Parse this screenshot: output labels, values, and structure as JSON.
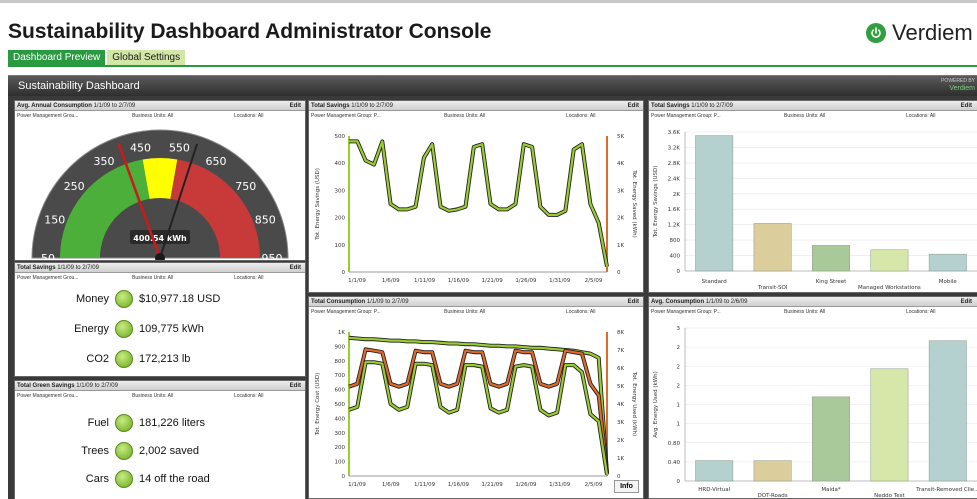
{
  "header": {
    "title": "Sustainability Dashboard Administrator Console",
    "logo_text": "Verdiem",
    "logo_suffix": "®"
  },
  "tabs": [
    {
      "label": "Dashboard Preview",
      "active": true
    },
    {
      "label": "Global Settings",
      "active": false
    }
  ],
  "dashboard": {
    "title": "Sustainability Dashboard",
    "powered_line1": "POWERED BY",
    "powered_line2": "Verdiem"
  },
  "filters": {
    "pmg": "Power Management Grou...",
    "pmg_short": "Power Management Group: P...",
    "bu": "Business Units: All",
    "loc": "Locations: All"
  },
  "panels": {
    "avg_annual": {
      "title": "Avg. Annual Consumption",
      "range": "1/1/09 to 2/7/09",
      "edit": "Edit"
    },
    "total_savings_1": {
      "title": "Total Savings",
      "range": "1/1/09 to 2/7/09",
      "edit": "Edit"
    },
    "green_savings": {
      "title": "Total Green Savings",
      "range": "1/1/09 to 2/7/09",
      "edit": "Edit"
    },
    "total_savings_line": {
      "title": "Total Savings",
      "range": "1/1/09 to 2/7/09",
      "edit": "Edit"
    },
    "total_consumption": {
      "title": "Total Consumption",
      "range": "1/1/09 to 2/7/09",
      "edit": "Edit"
    },
    "total_savings_bar": {
      "title": "Total Savings",
      "range": "1/1/09 to 2/7/09",
      "edit": "Edit"
    },
    "avg_consumption_bar": {
      "title": "Avg. Consumption",
      "range": "1/1/09 to 2/6/09",
      "edit": "Edit"
    }
  },
  "savings_metrics": [
    {
      "label": "Money",
      "value": "$10,977.18  USD",
      "icon": "money-icon"
    },
    {
      "label": "Energy",
      "value": "109,775  kWh",
      "icon": "bulb-icon"
    },
    {
      "label": "CO2",
      "value": "172,213  lb",
      "icon": "co2-icon"
    }
  ],
  "green_metrics": [
    {
      "label": "Fuel",
      "value": "181,226  liters",
      "icon": "fuel-icon"
    },
    {
      "label": "Trees",
      "value": "2,002  saved",
      "icon": "tree-icon"
    },
    {
      "label": "Cars",
      "value": "14  off the road",
      "icon": "car-icon"
    }
  ],
  "info_button": "Info",
  "chart_data": [
    {
      "type": "gauge",
      "tick_labels": [
        "50",
        "150",
        "250",
        "350",
        "450",
        "550",
        "650",
        "750",
        "850",
        "950"
      ],
      "value": 400.54,
      "value_label": "400.54 kWh",
      "zones": [
        {
          "from": 50,
          "to": 450,
          "color": "#4caf3a"
        },
        {
          "from": 450,
          "to": 550,
          "color": "#ffff00"
        },
        {
          "from": 550,
          "to": 950,
          "color": "#c83a3a"
        }
      ],
      "target": 590
    },
    {
      "type": "line",
      "x_ticks": [
        "1/1/09",
        "1/6/09",
        "1/11/09",
        "1/16/09",
        "1/21/09",
        "1/26/09",
        "1/31/09",
        "2/5/09"
      ],
      "ylabel": "Tot. Energy Savings (USD)",
      "y2label": "Tot. Energy Saved (kWh)",
      "ylim": [
        0,
        500
      ],
      "y_ticks": [
        "0",
        "100",
        "200",
        "300",
        "400",
        "500"
      ],
      "y2_ticks": [
        "0",
        "1K",
        "2K",
        "3K",
        "4K",
        "5K"
      ],
      "series": [
        {
          "color": "#9acd32",
          "values": [
            480,
            480,
            410,
            395,
            480,
            250,
            230,
            230,
            240,
            420,
            470,
            240,
            225,
            230,
            240,
            460,
            470,
            250,
            230,
            230,
            250,
            470,
            460,
            240,
            210,
            210,
            225,
            450,
            470,
            250,
            180,
            20
          ]
        }
      ]
    },
    {
      "type": "line",
      "x_ticks": [
        "1/1/09",
        "1/6/09",
        "1/11/09",
        "1/16/09",
        "1/21/09",
        "1/26/09",
        "1/31/09",
        "2/5/09"
      ],
      "ylabel": "Tot. Energy Cost (USD)",
      "y2label": "Tot. Energy Used (kWh)",
      "ylim": [
        0,
        1000
      ],
      "y_ticks": [
        "0",
        "100",
        "200",
        "300",
        "400",
        "500",
        "600",
        "700",
        "800",
        "900",
        "1K"
      ],
      "y2_ticks": [
        "0",
        "1K",
        "2K",
        "3K",
        "4K",
        "5K",
        "6K",
        "7K",
        "8K"
      ],
      "series": [
        {
          "color": "#9acd32",
          "values": [
            960,
            955,
            950,
            950,
            945,
            940,
            940,
            935,
            935,
            930,
            930,
            925,
            920,
            920,
            915,
            915,
            910,
            905,
            905,
            900,
            900,
            895,
            890,
            890,
            885,
            880,
            875,
            870,
            860,
            850,
            820,
            20
          ]
        },
        {
          "color": "#e06a2a",
          "values": [
            620,
            640,
            880,
            870,
            860,
            640,
            620,
            640,
            870,
            860,
            860,
            640,
            620,
            640,
            870,
            860,
            860,
            640,
            620,
            640,
            870,
            860,
            860,
            640,
            620,
            640,
            870,
            860,
            850,
            640,
            560,
            20
          ]
        },
        {
          "color": "#9acd32",
          "values": [
            460,
            480,
            790,
            790,
            780,
            500,
            460,
            480,
            780,
            780,
            770,
            480,
            440,
            460,
            770,
            770,
            760,
            470,
            440,
            460,
            760,
            770,
            760,
            460,
            420,
            440,
            770,
            770,
            720,
            430,
            380,
            10
          ]
        }
      ]
    },
    {
      "type": "bar",
      "categories": [
        "Standard",
        "Transit-SOI",
        "King Street",
        "Managed Workstations",
        "Mobile"
      ],
      "values": [
        3700,
        1300,
        700,
        580,
        460
      ],
      "colors": [
        "#b4d0cf",
        "#dccd9d",
        "#a9c99b",
        "#d7e6a9",
        "#b4d0cf"
      ],
      "ylabel": "Tot. Energy Savings (USD)",
      "ylim": [
        0,
        3800
      ],
      "y_ticks": [
        "0",
        "400",
        "800",
        "1.2K",
        "1.6K",
        "2K",
        "2.4K",
        "2.8K",
        "3.2K",
        "3.6K"
      ]
    },
    {
      "type": "bar",
      "categories": [
        "HRD-Virtual",
        "DOT-Roads",
        "Maida*",
        "Neddo Test",
        "Transit-Removed Clie..."
      ],
      "values": [
        0.4,
        0.4,
        1.65,
        2.2,
        2.75
      ],
      "colors": [
        "#b4d0cf",
        "#dccd9d",
        "#a9c99b",
        "#d7e6a9",
        "#b4d0cf"
      ],
      "ylabel": "Avg. Energy Used (kWh)",
      "ylim": [
        0,
        3
      ],
      "y_ticks": [
        "0",
        "0.40",
        "0.80",
        "1",
        "1",
        "2",
        "2",
        "2",
        "3"
      ]
    }
  ]
}
